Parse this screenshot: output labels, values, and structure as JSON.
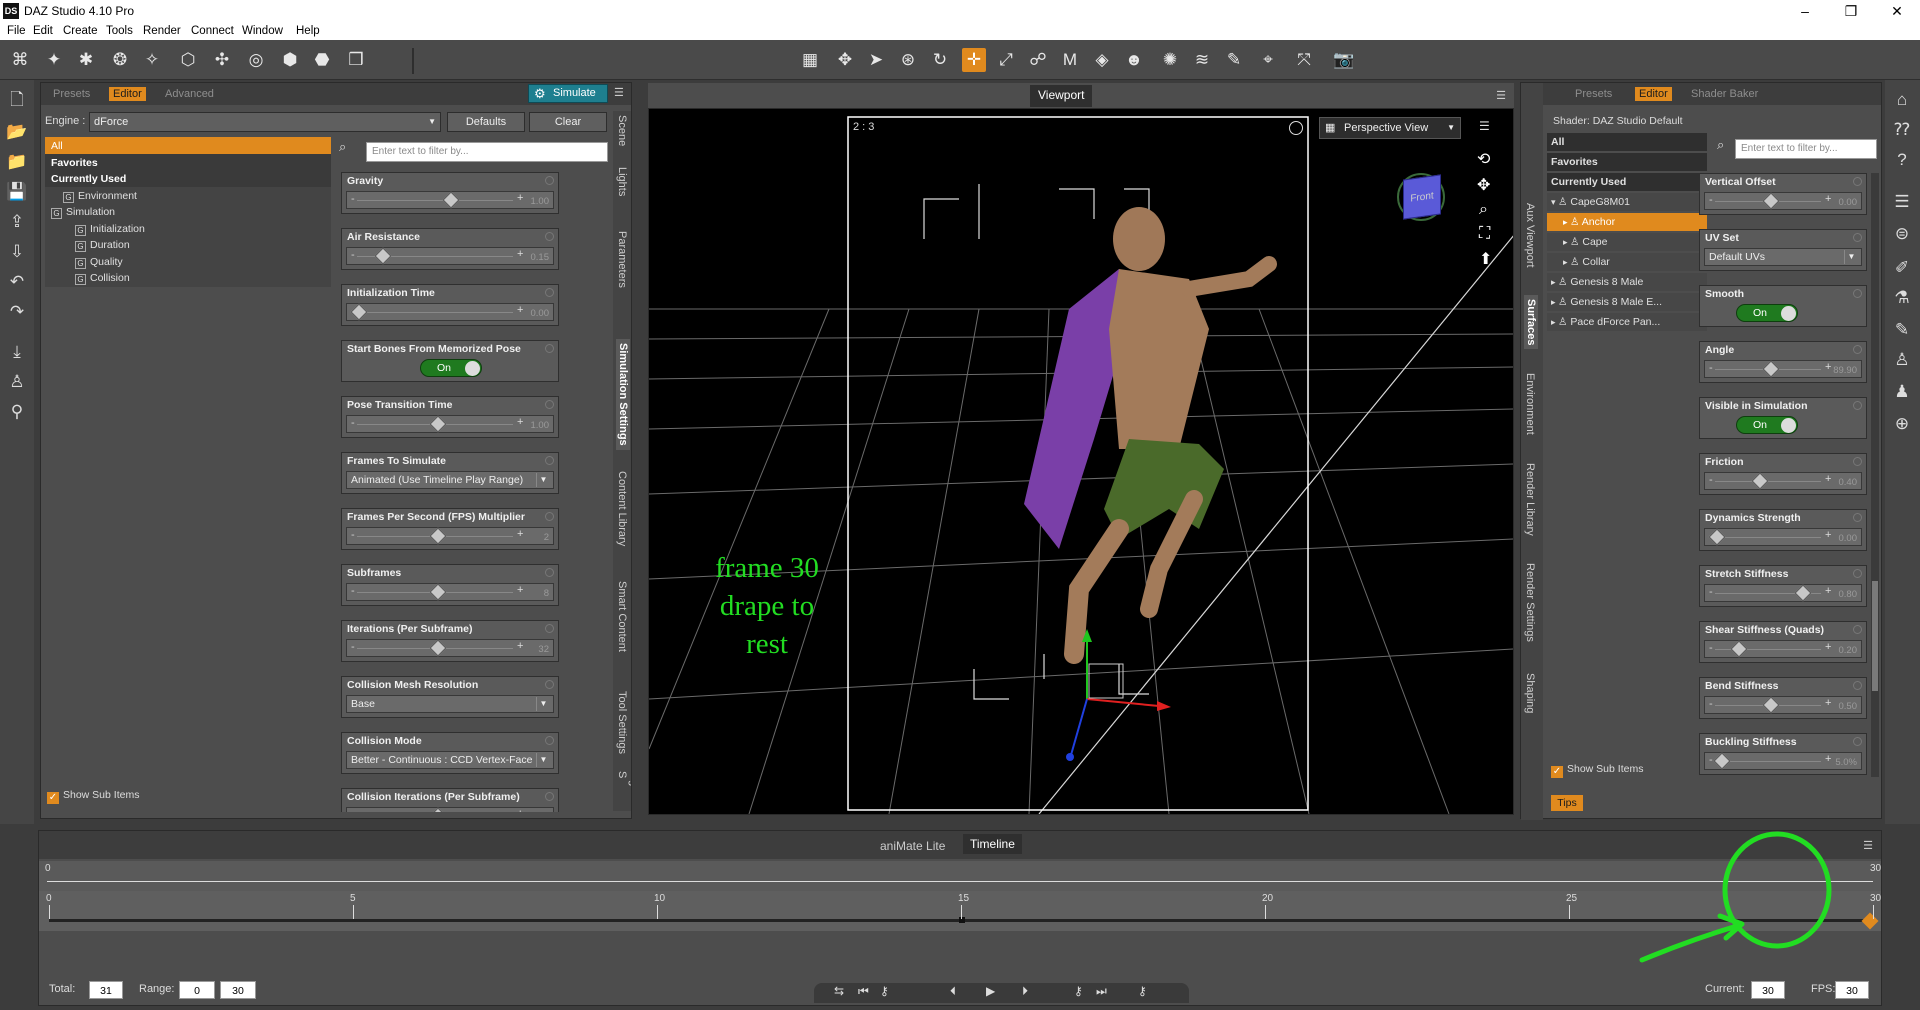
{
  "window": {
    "title": "DAZ Studio 4.10 Pro",
    "logo": "DS",
    "controls": [
      "–",
      "❐",
      "✕"
    ]
  },
  "menu": [
    "File",
    "Edit",
    "Create",
    "Tools",
    "Render",
    "Connect",
    "Window",
    "Help"
  ],
  "left_panel": {
    "tabs": [
      "Presets",
      "Editor",
      "Advanced"
    ],
    "active_tab": "Editor",
    "simulate_label": "Simulate",
    "engine_label": "Engine :",
    "engine_value": "dForce",
    "defaults_label": "Defaults",
    "clear_label": "Clear",
    "filter_placeholder": "Enter text to filter by...",
    "tree": [
      {
        "label": "All",
        "style": "sel",
        "indent": 0
      },
      {
        "label": "Favorites",
        "style": "bold",
        "indent": 0
      },
      {
        "label": "Currently Used",
        "style": "bold",
        "indent": 0
      },
      {
        "label": "Environment",
        "style": "",
        "indent": 1
      },
      {
        "label": "Simulation",
        "style": "",
        "indent": 0
      },
      {
        "label": "Initialization",
        "style": "",
        "indent": 2
      },
      {
        "label": "Duration",
        "style": "",
        "indent": 2
      },
      {
        "label": "Quality",
        "style": "",
        "indent": 2
      },
      {
        "label": "Collision",
        "style": "",
        "indent": 2
      }
    ],
    "show_sub_items": "Show Sub Items",
    "vertical_tabs": [
      "Scene",
      "Lights",
      "Parameters",
      "Simulation Settings",
      "Content Library",
      "Smart Content",
      "Tool Settings",
      "Figure S"
    ],
    "properties": [
      {
        "label": "Gravity",
        "kind": "slider",
        "value": "1.00",
        "knob": 0.58
      },
      {
        "label": "Air Resistance",
        "kind": "slider",
        "value": "0.15",
        "knob": 0.15
      },
      {
        "label": "Initialization Time",
        "kind": "slider",
        "value": "0.00",
        "knob": 0.0
      },
      {
        "label": "Start Bones From Memorized Pose",
        "kind": "toggle",
        "value": "On"
      },
      {
        "label": "Pose Transition Time",
        "kind": "slider",
        "value": "1.00",
        "knob": 0.5
      },
      {
        "label": "Frames To Simulate",
        "kind": "dropdown",
        "value": "Animated (Use Timeline Play Range)"
      },
      {
        "label": "Frames Per Second (FPS) Multiplier",
        "kind": "slider",
        "value": "2",
        "knob": 0.5
      },
      {
        "label": "Subframes",
        "kind": "slider",
        "value": "8",
        "knob": 0.5
      },
      {
        "label": "Iterations (Per Subframe)",
        "kind": "slider",
        "value": "32",
        "knob": 0.5
      },
      {
        "label": "Collision Mesh Resolution",
        "kind": "dropdown",
        "value": "Base"
      },
      {
        "label": "Collision Mode",
        "kind": "dropdown",
        "value": "Better - Continuous : CCD Vertex-Face"
      },
      {
        "label": "Collision Iterations (Per Subframe)",
        "kind": "slider",
        "value": "",
        "knob": 0.5
      }
    ]
  },
  "viewport": {
    "tab_label": "Viewport",
    "frame_ratio": "2 : 3",
    "view_name": "Perspective View",
    "cube_label": "Front",
    "annotation": [
      "frame 30",
      "drape to",
      "rest"
    ]
  },
  "right_panel": {
    "tabs": [
      "Presets",
      "Editor",
      "Shader Baker"
    ],
    "active_tab": "Editor",
    "shader_label": "Shader: DAZ Studio Default",
    "filter_placeholder": "Enter text to filter by...",
    "tree": [
      {
        "label": "All",
        "style": "dark",
        "indent": 0
      },
      {
        "label": "Favorites",
        "style": "dark",
        "indent": 0
      },
      {
        "label": "Currently Used",
        "style": "dark",
        "indent": 0
      },
      {
        "label": "CapeG8M01",
        "style": "",
        "indent": 0
      },
      {
        "label": "Anchor",
        "style": "sel",
        "indent": 1
      },
      {
        "label": "Cape",
        "style": "",
        "indent": 1
      },
      {
        "label": "Collar",
        "style": "",
        "indent": 1
      },
      {
        "label": "Genesis 8 Male",
        "style": "",
        "indent": 0
      },
      {
        "label": "Genesis 8 Male E...",
        "style": "",
        "indent": 0
      },
      {
        "label": "Pace dForce Pan...",
        "style": "",
        "indent": 0
      }
    ],
    "show_sub_items": "Show Sub Items",
    "tips_label": "Tips",
    "vertical_tabs": [
      "Aux Viewport",
      "Surfaces",
      "Environment",
      "Render Library",
      "Render Settings",
      "Shaping"
    ],
    "properties": [
      {
        "label": "Vertical Offset",
        "kind": "slider",
        "value": "0.00",
        "knob": 0.5
      },
      {
        "label": "UV Set",
        "kind": "dropdown",
        "value": "Default UVs"
      },
      {
        "label": "Smooth",
        "kind": "toggle",
        "value": "On"
      },
      {
        "label": "Angle",
        "kind": "slider",
        "value": "89.90",
        "knob": 0.5
      },
      {
        "label": "Visible in Simulation",
        "kind": "toggle",
        "value": "On"
      },
      {
        "label": "Friction",
        "kind": "slider",
        "value": "0.40",
        "knob": 0.4
      },
      {
        "label": "Dynamics Strength",
        "kind": "slider",
        "value": "0.00",
        "knob": 0.0
      },
      {
        "label": "Stretch Stiffness",
        "kind": "slider",
        "value": "0.80",
        "knob": 0.8
      },
      {
        "label": "Shear Stiffness (Quads)",
        "kind": "slider",
        "value": "0.20",
        "knob": 0.2
      },
      {
        "label": "Bend Stiffness",
        "kind": "slider",
        "value": "0.50",
        "knob": 0.5
      },
      {
        "label": "Buckling Stiffness",
        "kind": "slider",
        "value": "5.0%",
        "knob": 0.05
      }
    ]
  },
  "timeline": {
    "tabs": [
      "aniMate Lite",
      "Timeline"
    ],
    "active_tab": "Timeline",
    "range_ticks": [
      "0",
      "30"
    ],
    "frame_ticks": [
      "0",
      "5",
      "10",
      "15",
      "20",
      "25",
      "30"
    ],
    "total_label": "Total:",
    "total_value": "31",
    "range_label": "Range:",
    "range_start": "0",
    "range_end": "30",
    "current_label": "Current:",
    "current_value": "30",
    "fps_label": "FPS:",
    "fps_value": "30"
  },
  "colors": {
    "accent": "#e08a1e",
    "toggle_on": "#1f7a1f",
    "simulate": "#1e7f8f",
    "annotation": "#22dd22"
  }
}
